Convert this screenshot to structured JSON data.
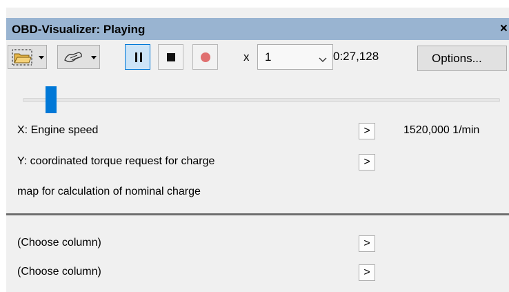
{
  "window": {
    "title": "OBD-Visualizer: Playing",
    "close_glyph": "×"
  },
  "toolbar": {
    "speed_prefix": "x",
    "speed_value": "1",
    "time": "0:27,128",
    "options_label": "Options..."
  },
  "playback": {
    "position_fraction": 0.05
  },
  "fields": {
    "x_label": "X: Engine speed",
    "x_value": "1520,000 1/min",
    "y_label": "Y: coordinated torque request for charge",
    "map_label": "map for calculation of nominal charge",
    "arrow_label": ">"
  },
  "columns": [
    {
      "label": "(Choose column)"
    },
    {
      "label": "(Choose column)"
    }
  ],
  "colors": {
    "titlebar": "#99b4d1",
    "accent": "#0078d7",
    "record": "#e07070"
  }
}
